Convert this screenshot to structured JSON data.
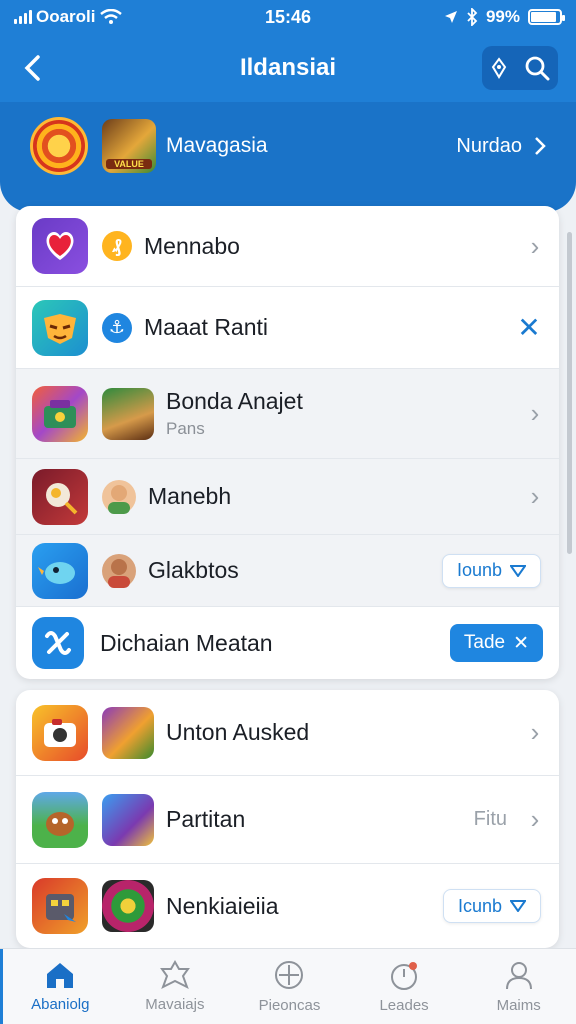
{
  "status": {
    "carrier": "Ooaroli",
    "time": "15:46",
    "battery": "99%"
  },
  "nav": {
    "title": "Ildansiai"
  },
  "hero": {
    "name": "Mavagasia",
    "avatar_tag": "VALUE",
    "link": "Nurdao"
  },
  "items": [
    {
      "title": "Mennabo",
      "sub": "",
      "action": "chevron"
    },
    {
      "title": "Maaat Ranti",
      "sub": "",
      "action": "close"
    },
    {
      "title": "Bonda Anajet",
      "sub": "Pans",
      "action": "chevron"
    },
    {
      "title": "Manebh",
      "sub": "",
      "action": "chevron"
    },
    {
      "title": "Glakbtos",
      "sub": "",
      "action": "pill",
      "pill": "Iounb"
    },
    {
      "title": "Dichaian Meatan",
      "sub": "",
      "action": "solid",
      "pill": "Tade"
    },
    {
      "title": "Unton Ausked",
      "sub": "",
      "action": "chevron"
    },
    {
      "title": "Partitan",
      "sub": "",
      "action": "text-chevron",
      "right_text": "Fitu"
    },
    {
      "title": "Nenkiaieiia",
      "sub": "",
      "action": "pill",
      "pill": "Icunb"
    }
  ],
  "tabs": [
    {
      "label": "Abaniolg"
    },
    {
      "label": "Mavaiajs"
    },
    {
      "label": "Pieoncas"
    },
    {
      "label": "Leades"
    },
    {
      "label": "Maims"
    }
  ]
}
